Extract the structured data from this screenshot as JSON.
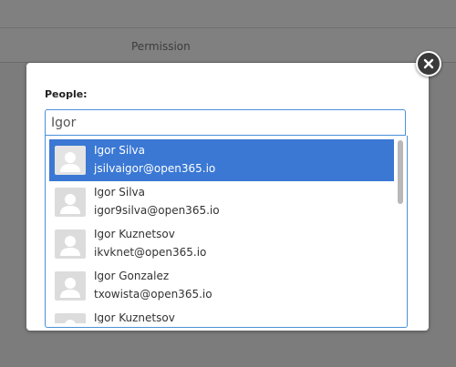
{
  "background": {
    "column_header": "Permission"
  },
  "dialog": {
    "field_label": "People:",
    "search": {
      "value": "Igor",
      "placeholder": ""
    },
    "results": [
      {
        "name": "Igor Silva",
        "email": "jsilvaigor@open365.io",
        "selected": true
      },
      {
        "name": "Igor Silva",
        "email": "igor9silva@open365.io",
        "selected": false
      },
      {
        "name": "Igor Kuznetsov",
        "email": "ikvknet@open365.io",
        "selected": false
      },
      {
        "name": "Igor Gonzalez",
        "email": "txowista@open365.io",
        "selected": false
      },
      {
        "name": "Igor Kuznetsov",
        "email": "",
        "selected": false
      }
    ]
  },
  "icons": {
    "close": "close-icon",
    "avatar": "user-placeholder-icon"
  },
  "colors": {
    "selected_row": "#3a78d4",
    "input_border": "#4a90d9",
    "overlay": "#7c7c7c"
  }
}
